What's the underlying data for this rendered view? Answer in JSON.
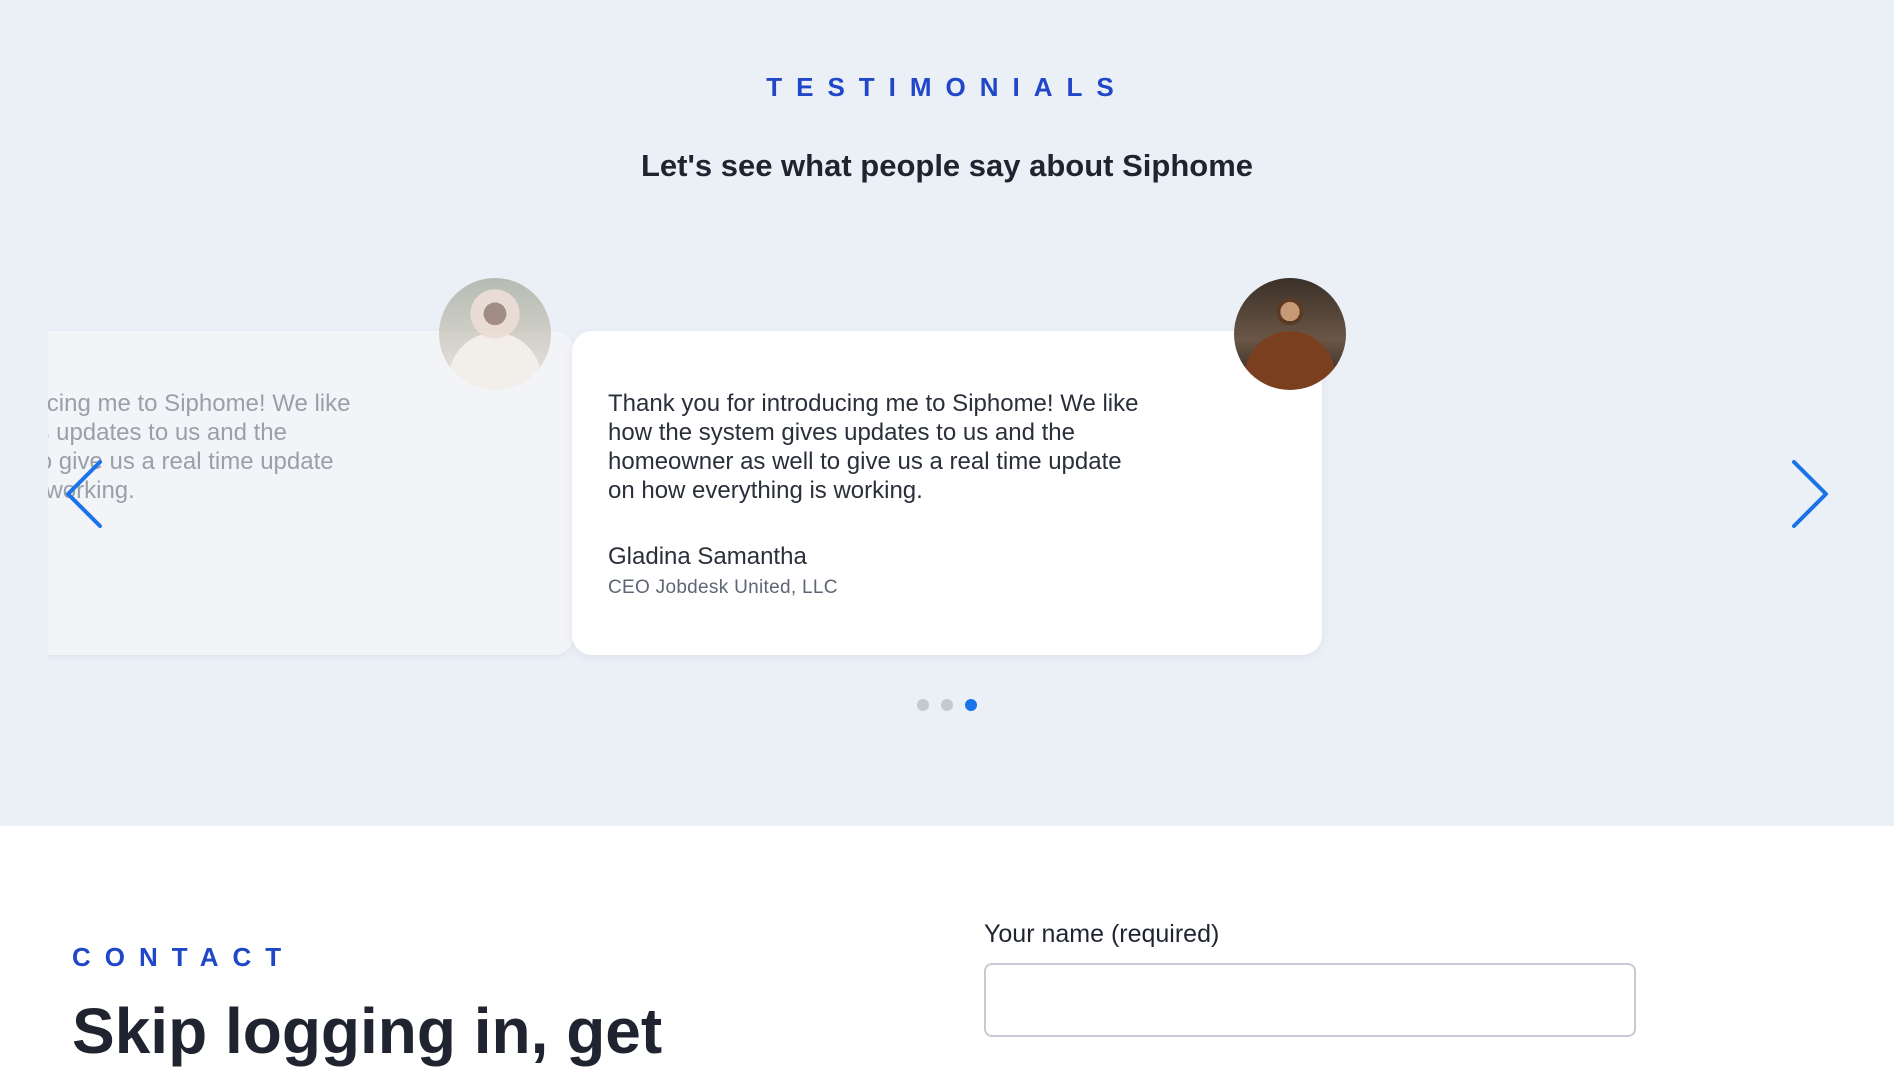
{
  "testimonials": {
    "eyebrow": "TESTIMONIALS",
    "heading": "Let's see what people say about Siphome",
    "slides": [
      {
        "quote": "Thank you for introducing me to Siphome! We like how the system gives updates to us and the homeowner as well to give us a real time update on how everything is working.",
        "author": "",
        "role": ""
      },
      {
        "quote": "Thank you for introducing me to Siphome! We like how the system gives updates to us and the homeowner as well to give us a real time update on how everything is working.",
        "author": "Gladina Samantha",
        "role": "CEO Jobdesk United, LLC"
      }
    ],
    "dots": 3,
    "active_dot": 3,
    "icons": {
      "prev": "chevron-left-icon",
      "next": "chevron-right-icon"
    },
    "accent_color": "#1a73e8"
  },
  "contact": {
    "eyebrow": "CONTACT",
    "title": "Skip logging in, get",
    "name_label": "Your name (required)",
    "name_value": ""
  }
}
